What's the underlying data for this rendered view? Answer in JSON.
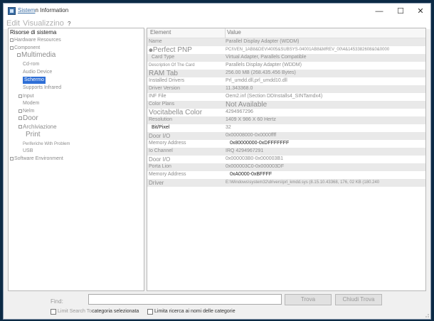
{
  "window": {
    "title_part1": "Sistem",
    "title_part2": "n Information",
    "minimize_glyph": "—",
    "maximize_glyph": "☐",
    "close_glyph": "✕"
  },
  "menu": {
    "edit": "Edit",
    "view": "Visualizzino",
    "help": "?"
  },
  "tree": {
    "root": "Risorse di sistema",
    "items": [
      {
        "label": "Hardware Resources"
      },
      {
        "label": "Component"
      },
      {
        "label": "Multimedia"
      },
      {
        "label": "Cd-rom"
      },
      {
        "label": "Audio Device"
      },
      {
        "label": "Schermo"
      },
      {
        "label": "Supports Infrared"
      },
      {
        "label": "Input"
      },
      {
        "label": "Modem"
      },
      {
        "label": "Nelm"
      },
      {
        "label": "Door"
      },
      {
        "label": "Archiviazione"
      },
      {
        "label": "Print"
      },
      {
        "label": "Periferiche With Problem"
      },
      {
        "label": "USB"
      },
      {
        "label": "Software Environment"
      }
    ]
  },
  "table": {
    "col_element": "Element",
    "col_value": "Value",
    "rows": [
      {
        "element": "Name",
        "value": "Parallel Display Adapter (WDDM)"
      },
      {
        "element": "Perfect PNP",
        "value": "PCI\\VEN_1AB8&DEV\\4005&SUBSYS-04001AB8&MREV_00\\4&1453382608&0&0000"
      },
      {
        "element": "Card Type",
        "value": "Virtual Adapter, Parallels Compatible"
      },
      {
        "element": "Description Of The Card",
        "value": "Parallels Display Adapter (WDDM)"
      },
      {
        "element": "RAM Tab",
        "value": "256.00 MB (268.435.456 Bytes)"
      },
      {
        "element": "Installed Drivers",
        "value": "Prl_umdd.dll,prl_umdd10.dll"
      },
      {
        "element": "Driver Version",
        "value": "11.343368.0"
      },
      {
        "element": "INF File",
        "value": "Oem2.inf (Section DDInstalls4_SINTamdx4)"
      },
      {
        "element": "Color Plans",
        "value": "Not Available"
      },
      {
        "element": "Vocitabella Color",
        "value": "4294967296"
      },
      {
        "element": "Resolution",
        "value": "1409 X 986 X 60 Hertz"
      },
      {
        "element": "Bit/Pixel",
        "value": "32"
      },
      {
        "element": "Door I/O",
        "value": "0x00008000-0x0000ffff"
      },
      {
        "element": "Memory Address",
        "value": "0x80000000-0xDFFFFFFF"
      },
      {
        "element": "Io Channel",
        "value": "IRQ 4294967291"
      },
      {
        "element": "Door I/O",
        "value": "0x000003B0-0x000003B1"
      },
      {
        "element": "Porta Lion",
        "value": "0x000003C0-0x000003DF"
      },
      {
        "element": "Memory Address",
        "value": "0xA0000-0xBFFFF"
      },
      {
        "element": "Driver",
        "value": "E:\\Windows\\system32\\drivers\\prl_kmdd.sys (8.15.10.43368, 176, 02 KB (180.240"
      }
    ]
  },
  "find": {
    "label": "Find:",
    "value": "",
    "find_button": "Trova",
    "close_button": "Chiudi Trova",
    "check1_part1": "Limit Search To",
    "check1_part2": "categoria selezionata",
    "check2": "Limita ricerca ai nomi delle categorie"
  },
  "colors": {
    "selection": "#2f6fd6",
    "row_shade": "#e9e9e9",
    "title_link": "#3a6ea5"
  }
}
